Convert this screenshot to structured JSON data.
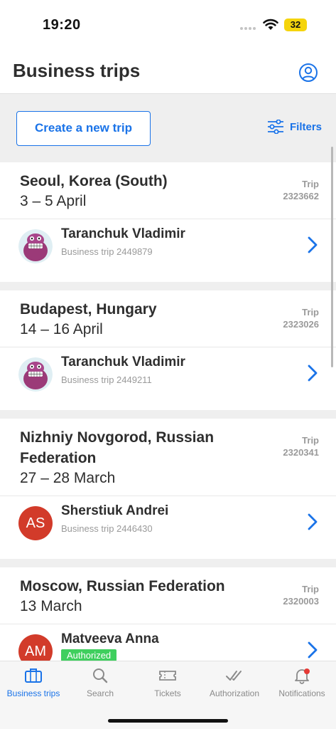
{
  "status": {
    "time": "19:20",
    "battery": "32"
  },
  "header": {
    "title": "Business trips"
  },
  "toolbar": {
    "create_label": "Create a new trip",
    "filters_label": "Filters"
  },
  "trips": [
    {
      "city": "Seoul, Korea (South)",
      "dates": "3 – 5 April",
      "label": "Trip",
      "number": "2323662",
      "person": "Taranchuk Vladimir",
      "sub": "Business trip 2449879"
    },
    {
      "city": "Budapest, Hungary",
      "dates": "14 – 16 April",
      "label": "Trip",
      "number": "2323026",
      "person": "Taranchuk Vladimir",
      "sub": "Business trip 2449211"
    },
    {
      "city": "Nizhniy Novgorod, Russian Federation",
      "dates": "27 – 28 March",
      "label": "Trip",
      "number": "2320341",
      "person": "Sherstiuk Andrei",
      "initials": "AS",
      "sub": "Business trip 2446430"
    },
    {
      "city": "Moscow, Russian Federation",
      "dates": "13 March",
      "label": "Trip",
      "number": "2320003",
      "person": "Matveeva Anna",
      "initials": "AM",
      "badge": "Authorized"
    }
  ],
  "tabs": [
    {
      "label": "Business trips",
      "icon": "briefcase-icon",
      "active": true
    },
    {
      "label": "Search",
      "icon": "search-icon"
    },
    {
      "label": "Tickets",
      "icon": "ticket-icon"
    },
    {
      "label": "Authorization",
      "icon": "double-check-icon"
    },
    {
      "label": "Notifications",
      "icon": "bell-icon"
    }
  ],
  "colors": {
    "accent": "#1a73e8",
    "badge": "#3fcf5e",
    "avatar_red": "#d23b2a"
  }
}
